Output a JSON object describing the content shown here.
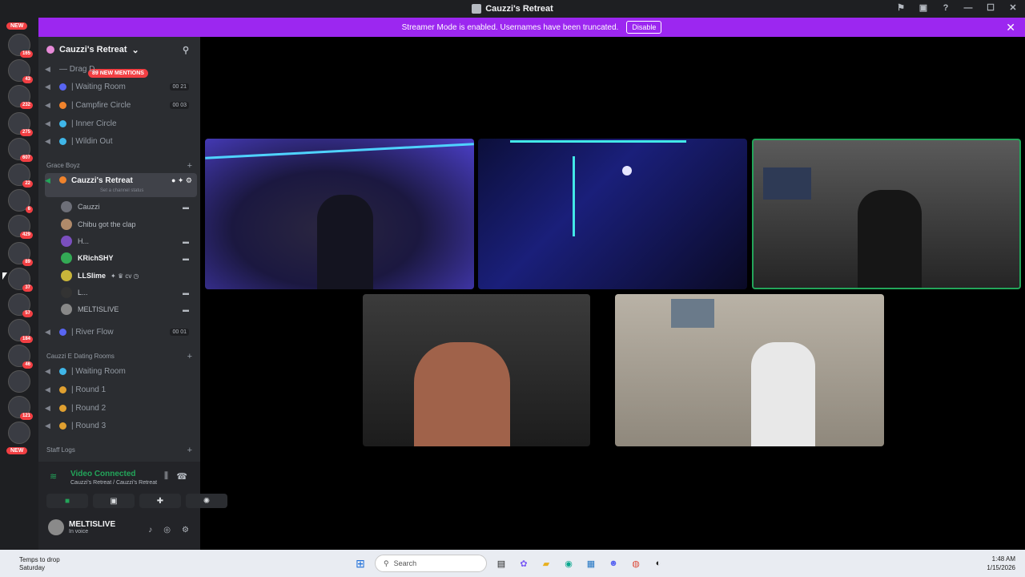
{
  "window": {
    "title": "Cauzzi's Retreat"
  },
  "banner": {
    "text": "Streamer Mode is enabled. Usernames have been truncated.",
    "disable_label": "Disable",
    "close": "✕"
  },
  "servers": {
    "new_top": "NEW",
    "new_bottom": "NEW",
    "badges": [
      "165",
      "43",
      "232",
      "275",
      "607",
      "22",
      "6",
      "429",
      "89",
      "37",
      "57",
      "184",
      "46",
      "121"
    ]
  },
  "sidebar": {
    "server_name": "Cauzzi's Retreat",
    "mentions": "89 NEW MENTIONS",
    "channels_top": [
      {
        "name": "— Drag D...",
        "count": ""
      },
      {
        "name": "| Waiting Room",
        "count": "00  21"
      },
      {
        "name": "| Campfire Circle",
        "count": "00  03"
      },
      {
        "name": "| Inner Circle",
        "count": ""
      },
      {
        "name": "| Wildin Out",
        "count": ""
      }
    ],
    "category_grace": "Grace Boyz",
    "active_channel": "Cauzzi's Retreat",
    "channel_status": "Set a channel status",
    "users": [
      "Cauzzi",
      "Chibu got the clap",
      "H...",
      "KRichSHY",
      "LLSlime",
      "L...",
      "MELTISLIVE"
    ],
    "river_flow": {
      "name": "| River Flow",
      "count": "00  01"
    },
    "category_dating": "Cauzzi E Dating Rooms",
    "dating_channels": [
      "| Waiting Room",
      "| Round 1",
      "| Round 2",
      "| Round 3"
    ],
    "category_staff": "Staff Logs"
  },
  "voice": {
    "status": "Video Connected",
    "location": "Cauzzi's Retreat / Cauzzi's Retreat",
    "user": "MELTISLIVE",
    "user_status": "In voice"
  },
  "taskbar": {
    "weather": "Temps to drop",
    "weather_sub": "Saturday",
    "search": "Search",
    "time": "1:48 AM",
    "date": "1/15/2026"
  },
  "colors": {
    "banner": "#9c27f0",
    "sidebar": "#2b2d31",
    "serverbar": "#1e1f22",
    "connected": "#23a55a",
    "badge": "#f23f43"
  }
}
